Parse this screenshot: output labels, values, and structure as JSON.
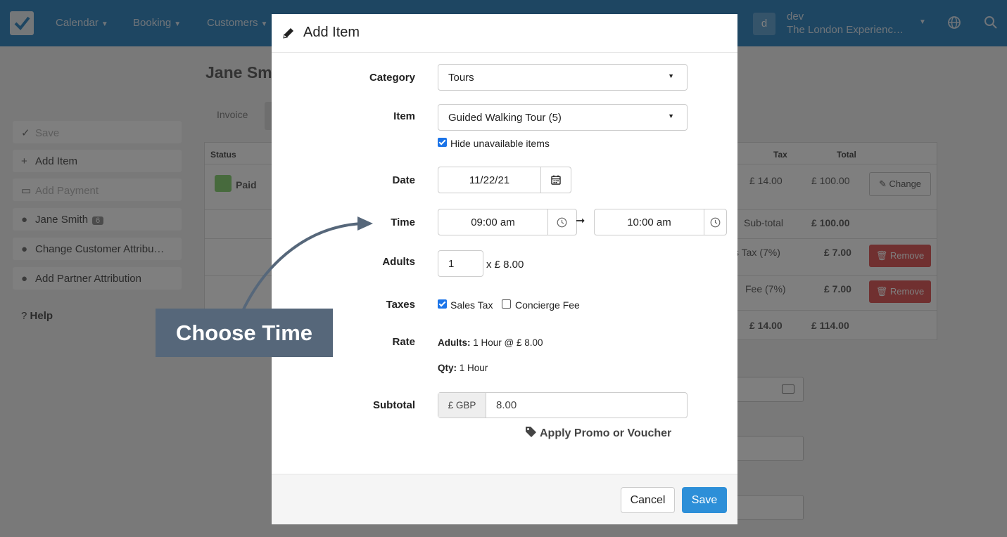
{
  "navbar": {
    "items": [
      {
        "label": "Calendar"
      },
      {
        "label": "Booking"
      },
      {
        "label": "Customers"
      }
    ],
    "avatar_letter": "d",
    "user_name": "dev",
    "company": "The London Experienc…"
  },
  "sidebar": {
    "save_label": "Save",
    "add_item_label": "Add Item",
    "add_payment_label": "Add Payment",
    "customer_label": "Jane Smith",
    "customer_badge": "6",
    "change_attrib_label": "Change Customer Attribu…",
    "partner_attrib_label": "Add Partner Attribution",
    "help_label": "Help"
  },
  "background": {
    "page_title": "Jane Sm",
    "tab_invoice": "Invoice",
    "table": {
      "headers": {
        "status": "Status",
        "tax": "Tax",
        "total": "Total"
      },
      "row1": {
        "status": "Paid",
        "tax": "£ 14.00",
        "total": "£ 100.00",
        "action": "Change"
      },
      "subtotal": {
        "label": "Sub-total",
        "value": "£ 100.00"
      },
      "row_sales_tax": {
        "label": "s Tax (7%)",
        "value": "£ 7.00",
        "action": "Remove"
      },
      "row_fee": {
        "label": "Fee (7%)",
        "value": "£ 7.00",
        "action": "Remove"
      },
      "totals": {
        "tax": "£ 14.00",
        "total": "£ 114.00"
      }
    }
  },
  "modal": {
    "title": "Add Item",
    "category": {
      "label": "Category",
      "value": "Tours"
    },
    "item": {
      "label": "Item",
      "value": "Guided Walking Tour (5)",
      "hide_unavailable_label": "Hide unavailable items",
      "hide_unavailable_checked": true
    },
    "date": {
      "label": "Date",
      "value": "11/22/21"
    },
    "time": {
      "label": "Time",
      "start": "09:00 am",
      "end": "10:00 am",
      "separator": "➞"
    },
    "adults": {
      "label": "Adults",
      "value": "1",
      "price": "x £ 8.00"
    },
    "taxes": {
      "label": "Taxes",
      "sales_tax_label": "Sales Tax",
      "sales_tax_checked": true,
      "concierge_label": "Concierge Fee",
      "concierge_checked": false
    },
    "rate": {
      "label": "Rate",
      "adults_label": "Adults:",
      "adults_value": "1 Hour @ £ 8.00",
      "qty_label": "Qty:",
      "qty_value": "1 Hour"
    },
    "subtotal": {
      "label": "Subtotal",
      "currency": "£ GBP",
      "value": "8.00"
    },
    "promo_label": "Apply Promo or Voucher",
    "cancel_label": "Cancel",
    "save_label": "Save"
  },
  "callout": {
    "text": "Choose Time"
  },
  "colors": {
    "navbar": "#3c8dc5",
    "primary": "#2d8fd8",
    "callout": "#56677a",
    "danger": "#e06060",
    "paid": "#8fd47a"
  }
}
